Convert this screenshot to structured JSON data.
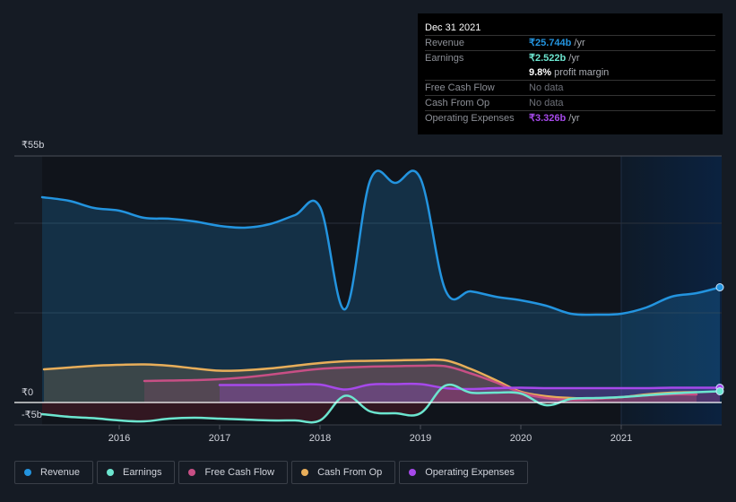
{
  "tooltip": {
    "date": "Dec 31 2021",
    "rows": [
      {
        "label": "Revenue",
        "value": "₹25.744b",
        "unit": " /yr",
        "color": "#2394df"
      },
      {
        "label": "Earnings",
        "value": "₹2.522b",
        "unit": " /yr",
        "color": "#6ce5cf"
      },
      {
        "label": "",
        "value": "9.8%",
        "unit": " profit margin",
        "color": "#ffffff"
      },
      {
        "label": "Free Cash Flow",
        "value": "No data",
        "unit": "",
        "color": "#6e7179"
      },
      {
        "label": "Cash From Op",
        "value": "No data",
        "unit": "",
        "color": "#6e7179"
      },
      {
        "label": "Operating Expenses",
        "value": "₹3.326b",
        "unit": " /yr",
        "color": "#a649ea"
      }
    ]
  },
  "legend": [
    {
      "label": "Revenue",
      "color": "#2394df"
    },
    {
      "label": "Earnings",
      "color": "#6ce5cf"
    },
    {
      "label": "Free Cash Flow",
      "color": "#c84f85"
    },
    {
      "label": "Cash From Op",
      "color": "#e8ae5a"
    },
    {
      "label": "Operating Expenses",
      "color": "#a649ea"
    }
  ],
  "chart_data": {
    "type": "area",
    "title": "",
    "xlabel": "",
    "ylabel": "",
    "y_tick_labels": [
      "₹55b",
      "₹0",
      "-₹5b"
    ],
    "ylim": [
      -5,
      55
    ],
    "x_tick_labels": [
      "2016",
      "2017",
      "2018",
      "2019",
      "2020",
      "2021"
    ],
    "x_range": [
      2015.25,
      2022.0
    ],
    "grid": true,
    "legend_position": "bottom",
    "highlight_from": 2021.0,
    "series": [
      {
        "name": "Revenue",
        "color": "#2394df",
        "x": [
          2015.25,
          2015.5,
          2015.75,
          2016.0,
          2016.25,
          2016.5,
          2016.75,
          2017.0,
          2017.25,
          2017.5,
          2017.75,
          2018.0,
          2018.25,
          2018.5,
          2018.75,
          2019.0,
          2019.25,
          2019.5,
          2019.75,
          2020.0,
          2020.25,
          2020.5,
          2020.75,
          2021.0,
          2021.25,
          2021.5,
          2021.75,
          2022.0
        ],
        "values": [
          45.8,
          45.0,
          43.4,
          42.8,
          41.2,
          41.0,
          40.4,
          39.4,
          39.0,
          39.8,
          41.8,
          43.6,
          20.8,
          49.6,
          49.0,
          50.0,
          25.0,
          24.8,
          23.6,
          22.8,
          21.6,
          19.8,
          19.6,
          19.8,
          21.2,
          23.6,
          24.4,
          25.7
        ]
      },
      {
        "name": "Earnings",
        "color": "#6ce5cf",
        "x": [
          2015.25,
          2015.5,
          2015.75,
          2016.0,
          2016.25,
          2016.5,
          2016.75,
          2017.0,
          2017.25,
          2017.5,
          2017.75,
          2018.0,
          2018.25,
          2018.5,
          2018.75,
          2019.0,
          2019.25,
          2019.5,
          2019.75,
          2020.0,
          2020.25,
          2020.5,
          2020.75,
          2021.0,
          2021.25,
          2021.5,
          2021.75,
          2022.0
        ],
        "values": [
          -2.6,
          -3.2,
          -3.5,
          -4.0,
          -4.2,
          -3.6,
          -3.4,
          -3.6,
          -3.8,
          -4.0,
          -4.0,
          -4.0,
          1.5,
          -2.0,
          -2.4,
          -2.4,
          3.8,
          2.2,
          2.2,
          2.0,
          -0.6,
          0.8,
          1.0,
          1.2,
          1.6,
          2.0,
          2.3,
          2.5
        ]
      },
      {
        "name": "Free Cash Flow",
        "color": "#c84f85",
        "x": [
          2016.25,
          2016.5,
          2016.75,
          2017.0,
          2017.25,
          2017.5,
          2017.75,
          2018.0,
          2018.25,
          2018.5,
          2018.75,
          2019.0,
          2019.25,
          2019.5,
          2019.75,
          2020.0,
          2020.25,
          2020.5,
          2020.75,
          2021.0,
          2021.25,
          2021.5,
          2021.75
        ],
        "values": [
          4.8,
          4.9,
          5.0,
          5.2,
          5.6,
          6.2,
          6.9,
          7.5,
          7.8,
          8.0,
          8.1,
          8.2,
          8.1,
          6.5,
          4.5,
          2.2,
          1.0,
          0.6,
          0.8,
          1.2,
          1.6,
          1.8,
          1.8
        ]
      },
      {
        "name": "Cash From Op",
        "color": "#e8ae5a",
        "x": [
          2015.25,
          2015.5,
          2015.75,
          2016.0,
          2016.25,
          2016.5,
          2016.75,
          2017.0,
          2017.25,
          2017.5,
          2017.75,
          2018.0,
          2018.25,
          2018.5,
          2018.75,
          2019.0,
          2019.25,
          2019.5,
          2019.75,
          2020.0,
          2020.25,
          2020.5,
          2020.75,
          2021.0,
          2021.25,
          2021.5,
          2021.75
        ],
        "values": [
          7.4,
          7.8,
          8.2,
          8.4,
          8.5,
          8.2,
          7.6,
          7.1,
          7.2,
          7.6,
          8.2,
          8.8,
          9.2,
          9.3,
          9.4,
          9.5,
          9.4,
          7.5,
          5.0,
          2.4,
          1.4,
          1.0,
          0.9,
          1.2,
          1.8,
          2.2,
          2.3
        ]
      },
      {
        "name": "Operating Expenses",
        "color": "#a649ea",
        "x": [
          2017.0,
          2017.25,
          2017.5,
          2017.75,
          2018.0,
          2018.25,
          2018.5,
          2018.75,
          2019.0,
          2019.25,
          2019.5,
          2019.75,
          2020.0,
          2020.25,
          2020.5,
          2020.75,
          2021.0,
          2021.25,
          2021.5,
          2021.75,
          2022.0
        ],
        "values": [
          3.9,
          3.9,
          3.9,
          4.0,
          4.0,
          2.9,
          4.0,
          4.1,
          4.1,
          3.2,
          3.0,
          3.2,
          3.3,
          3.2,
          3.2,
          3.2,
          3.2,
          3.2,
          3.3,
          3.3,
          3.3
        ]
      }
    ]
  }
}
